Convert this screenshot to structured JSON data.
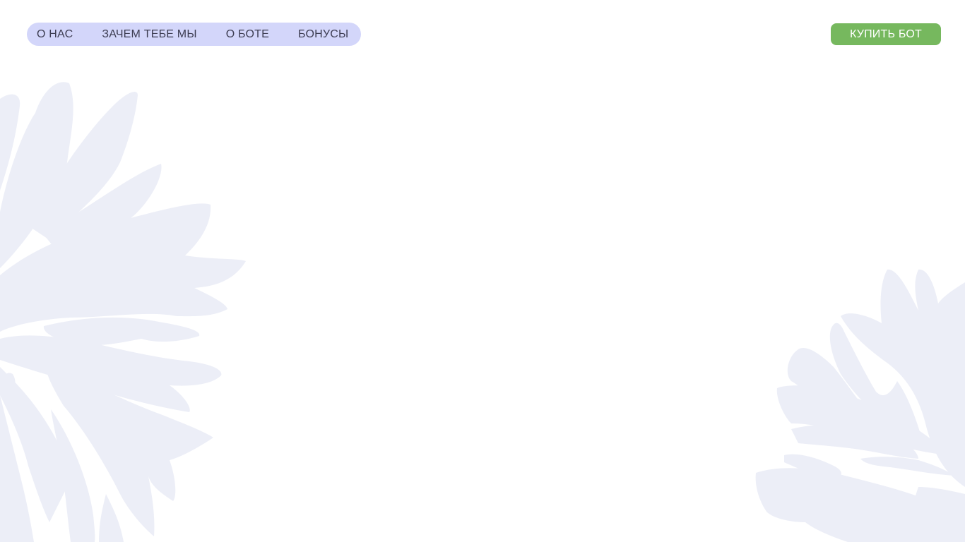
{
  "nav": {
    "items": [
      {
        "label": "О НАС"
      },
      {
        "label": "ЗАЧЕМ ТЕБЕ МЫ"
      },
      {
        "label": "О БОТЕ"
      },
      {
        "label": "БОНУСЫ"
      }
    ]
  },
  "header": {
    "buy_label": "КУПИТЬ БОТ"
  },
  "colors": {
    "background": "#ffffff",
    "nav_pill": "#d3d6fa",
    "nav_text": "#3d3d52",
    "buy_button": "#76b85e",
    "decoration": "#eceef7"
  },
  "decorations": {
    "left": "cornflower-decoration",
    "right": "cornflower-decoration"
  }
}
